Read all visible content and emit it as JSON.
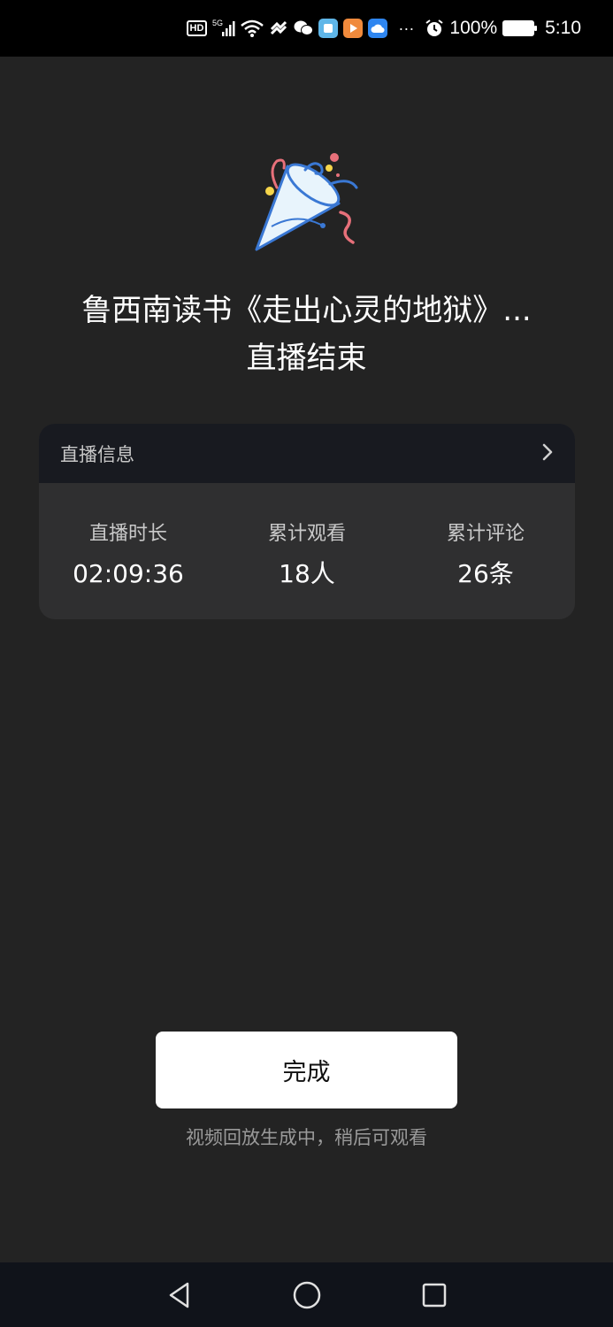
{
  "status_bar": {
    "hd_label": "HD",
    "network": "5G",
    "more": "···",
    "battery_percent": "100%",
    "time": "5:10"
  },
  "live_end": {
    "title": "鲁西南读书《走出心灵的地狱》...",
    "subtitle": "直播结束"
  },
  "info_card": {
    "header_label": "直播信息",
    "stats": [
      {
        "label": "直播时长",
        "value": "02:09:36"
      },
      {
        "label": "累计观看",
        "value": "18人"
      },
      {
        "label": "累计评论",
        "value": "26条"
      }
    ]
  },
  "actions": {
    "done_label": "完成",
    "hint": "视频回放生成中，稍后可观看"
  },
  "icons": {
    "celebration": "party-popper-icon",
    "chevron": "chevron-right-icon",
    "nav": [
      "back-icon",
      "home-icon",
      "recents-icon"
    ]
  },
  "colors": {
    "background": "#232323",
    "card_header": "#181a20",
    "card_body": "#2f2f30",
    "button": "#ffffff",
    "nav_bar": "#10131a"
  }
}
